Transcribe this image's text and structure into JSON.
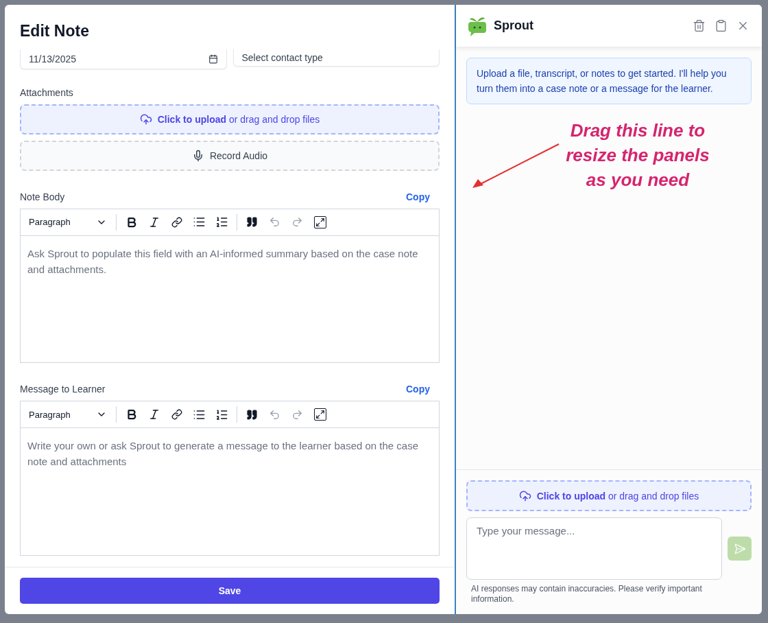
{
  "dialog": {
    "title": "Edit Note",
    "date_field": {
      "value": "11/13/2025"
    },
    "contact_type_select": {
      "placeholder": "Select contact type"
    },
    "attachments": {
      "label": "Attachments",
      "upload": {
        "link": "Click to upload",
        "rest": "or drag and drop files"
      },
      "record_button": "Record Audio"
    },
    "editors": [
      {
        "label": "Note Body",
        "copy": "Copy",
        "format": "Paragraph",
        "placeholder": "Ask Sprout to populate this field with an AI-informed summary based on the case note and attachments."
      },
      {
        "label": "Message to Learner",
        "copy": "Copy",
        "format": "Paragraph",
        "placeholder": "Write your own or ask Sprout to generate a message to the learner based on the case note and attachments"
      }
    ],
    "save_button": "Save"
  },
  "assistant": {
    "name": "Sprout",
    "info": "Upload a file, transcript, or notes to get started. I'll help you turn them into a case note or a message for the learner.",
    "annotation": "Drag this line to resize the panels as you need",
    "upload": {
      "link": "Click to upload",
      "rest": "or drag and drop files"
    },
    "message": {
      "placeholder": "Type your message..."
    },
    "send_button": {
      "disabled": true
    },
    "disclaimer": "AI responses may contain inaccuracies. Please verify important information."
  }
}
